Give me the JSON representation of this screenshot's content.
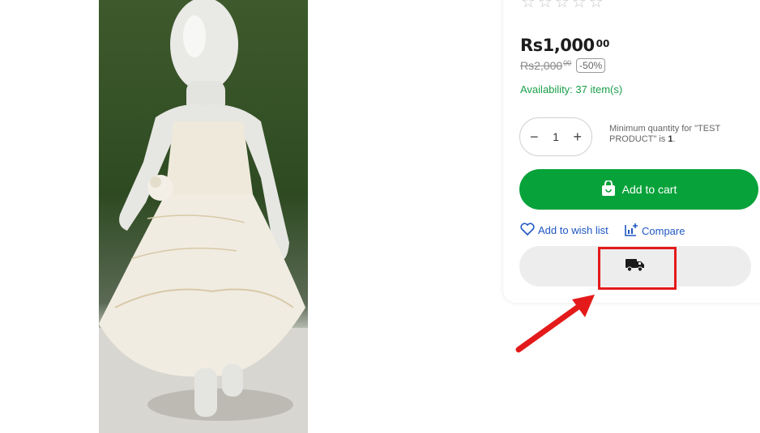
{
  "rating": {
    "stars": "☆☆☆☆☆"
  },
  "price": {
    "current": "Rs1,000",
    "current_cents": "00",
    "original": "Rs2,000",
    "original_cents": "00",
    "discount": "-50%"
  },
  "availability": "Availability: 37 item(s)",
  "quantity": {
    "minus": "−",
    "value": "1",
    "plus": "+",
    "note_prefix": "Minimum quantity for \"TEST PRODUCT\" is ",
    "note_value": "1",
    "note_suffix": "."
  },
  "actions": {
    "add_to_cart": "Add to cart",
    "wishlist": "Add to wish list",
    "compare": "Compare"
  },
  "icons": [
    "shopping-bag-icon",
    "heart-icon",
    "compare-icon",
    "truck-icon"
  ],
  "colors": {
    "accent_green": "#08a23a",
    "link_blue": "#1f57c3",
    "annotation_red": "#e41a1a"
  }
}
